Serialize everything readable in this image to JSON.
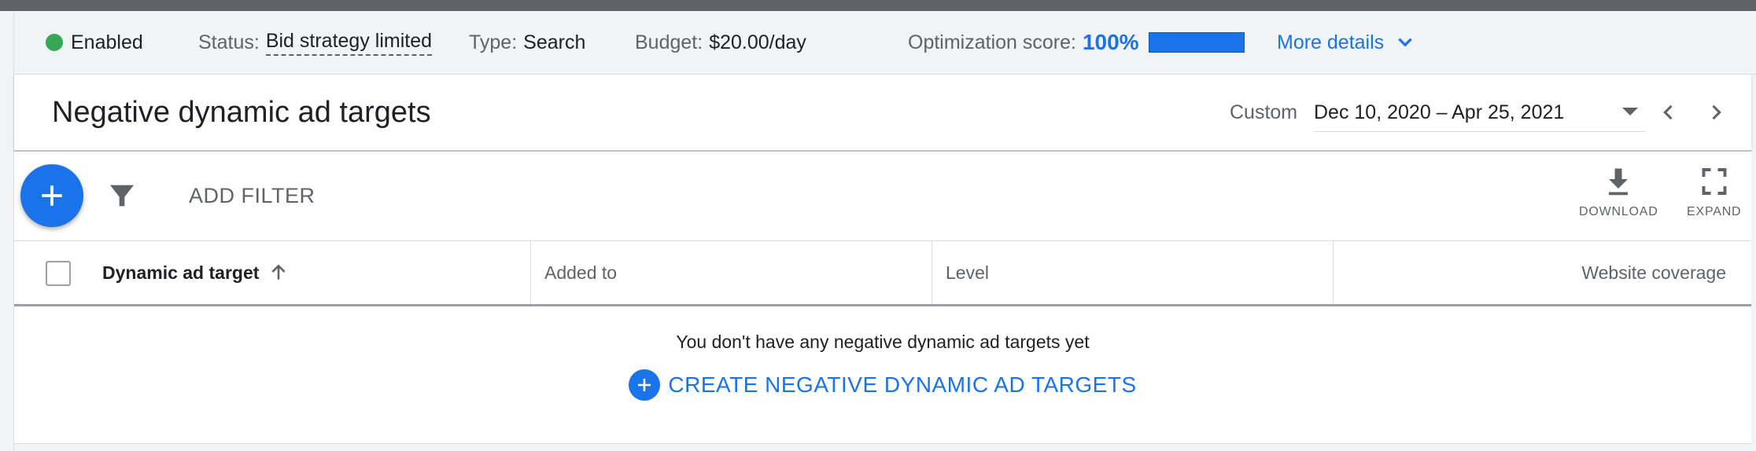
{
  "status_bar": {
    "enabled_label": "Enabled",
    "status_label": "Status:",
    "status_value": "Bid strategy limited",
    "type_label": "Type:",
    "type_value": "Search",
    "budget_label": "Budget:",
    "budget_value": "$20.00/day",
    "optimization_label": "Optimization score:",
    "optimization_value": "100%",
    "optimization_fraction": 1.0,
    "more_details": "More details"
  },
  "header": {
    "title": "Negative dynamic ad targets",
    "date_label": "Custom",
    "date_range": "Dec 10, 2020 – Apr 25, 2021"
  },
  "toolbar": {
    "add_filter": "ADD FILTER",
    "download": "DOWNLOAD",
    "expand": "EXPAND"
  },
  "table": {
    "columns": [
      "Dynamic ad target",
      "Added to",
      "Level",
      "Website coverage"
    ],
    "empty_message": "You don't have any negative dynamic ad targets yet",
    "create_label": "CREATE NEGATIVE DYNAMIC AD TARGETS"
  },
  "colors": {
    "accent": "#1a73e8",
    "enabled": "#34a853"
  },
  "icons": {
    "enabled": "green-dot-icon",
    "more": "chevron-down-icon",
    "fab": "plus-icon",
    "filter": "filter-icon",
    "download": "download-icon",
    "expand": "fullscreen-icon",
    "sort": "arrow-up-icon",
    "prev": "chevron-left-icon",
    "next": "chevron-right-icon",
    "create": "plus-circle-icon"
  }
}
